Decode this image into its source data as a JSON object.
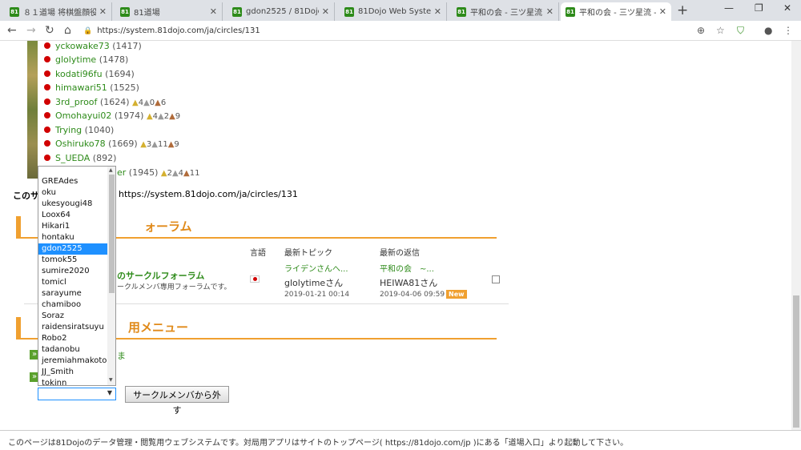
{
  "browser": {
    "tabs": [
      {
        "title": "８１道場 将棋盤顔役",
        "active": false
      },
      {
        "title": "81道場",
        "active": false
      },
      {
        "title": "gdon2525 / 81Dojo We",
        "active": false
      },
      {
        "title": "81Dojo Web System",
        "active": false
      },
      {
        "title": "平和の会 - 三ツ星流 - /",
        "active": false
      },
      {
        "title": "平和の会 - 三ツ星流 - /",
        "active": true
      }
    ],
    "url": "https://system.81dojo.com/ja/circles/131"
  },
  "members": [
    {
      "name": "yckowake73",
      "rating": "(1417)",
      "medals": null
    },
    {
      "name": "glolytime",
      "rating": "(1478)",
      "medals": null
    },
    {
      "name": "kodati96fu",
      "rating": "(1694)",
      "medals": null
    },
    {
      "name": "himawari51",
      "rating": "(1525)",
      "medals": null
    },
    {
      "name": "3rd_proof",
      "rating": "(1624)",
      "medals": {
        "gold": "4",
        "silver": "0",
        "bronze": "6"
      }
    },
    {
      "name": "Omohayui02",
      "rating": "(1974)",
      "medals": {
        "gold": "4",
        "silver": "2",
        "bronze": "9"
      }
    },
    {
      "name": "Trying",
      "rating": "(1040)",
      "medals": null
    },
    {
      "name": "Oshiruko78",
      "rating": "(1669)",
      "medals": {
        "gold": "3",
        "silver": "11",
        "bronze": "9"
      }
    },
    {
      "name": "S_UEDA",
      "rating": "(892)",
      "medals": null
    },
    {
      "name": "er",
      "rating": "(1945)",
      "medals": {
        "gold": "2",
        "silver": "4",
        "bronze": "11"
      }
    }
  ],
  "circle_note": {
    "prefix": "このサ",
    "url": "https://system.81dojo.com/ja/circles/131"
  },
  "forum_section": {
    "heading_visible": "ォーラム",
    "columns": {
      "lang": "言語",
      "topic": "最新トピック",
      "reply": "最新の返信"
    },
    "row": {
      "title_tail": "のサークルフォーラム",
      "desc_tail": "ークルメンバ専用フォーラムです。",
      "topic_title": "ライデンさんへ...",
      "topic_author": "glolytimeさん",
      "topic_date": "2019-01-21 00:14",
      "reply_title": "平和の会　~...",
      "reply_author": "HEIWA81さん",
      "reply_date": "2019-04-06 09:59",
      "new_badge": "New"
    }
  },
  "menu_section": {
    "heading_visible": "用メニュー",
    "link_tail": "ま"
  },
  "member_select": {
    "options": [
      "GREAdes",
      "oku",
      "ukesyougi48",
      "Loox64",
      "Hikari1",
      "hontaku",
      "gdon2525",
      "tomok55",
      "sumire2020",
      "tomicl",
      "sarayume",
      "chamiboo",
      "Soraz",
      "raidensiratsuyu",
      "Robo2",
      "tadanobu",
      "jeremiahmakoto",
      "JJ_Smith",
      "tokinn"
    ],
    "selected_index": 6,
    "current_value": ""
  },
  "remove_button": "サークルメンバから外す",
  "footer": "このページは81Dojoのデータ管理・閲覧用ウェブシステムです。対局用アプリはサイトのトップページ( https://81dojo.com/jp )にある「道場入口」より起動して下さい。"
}
